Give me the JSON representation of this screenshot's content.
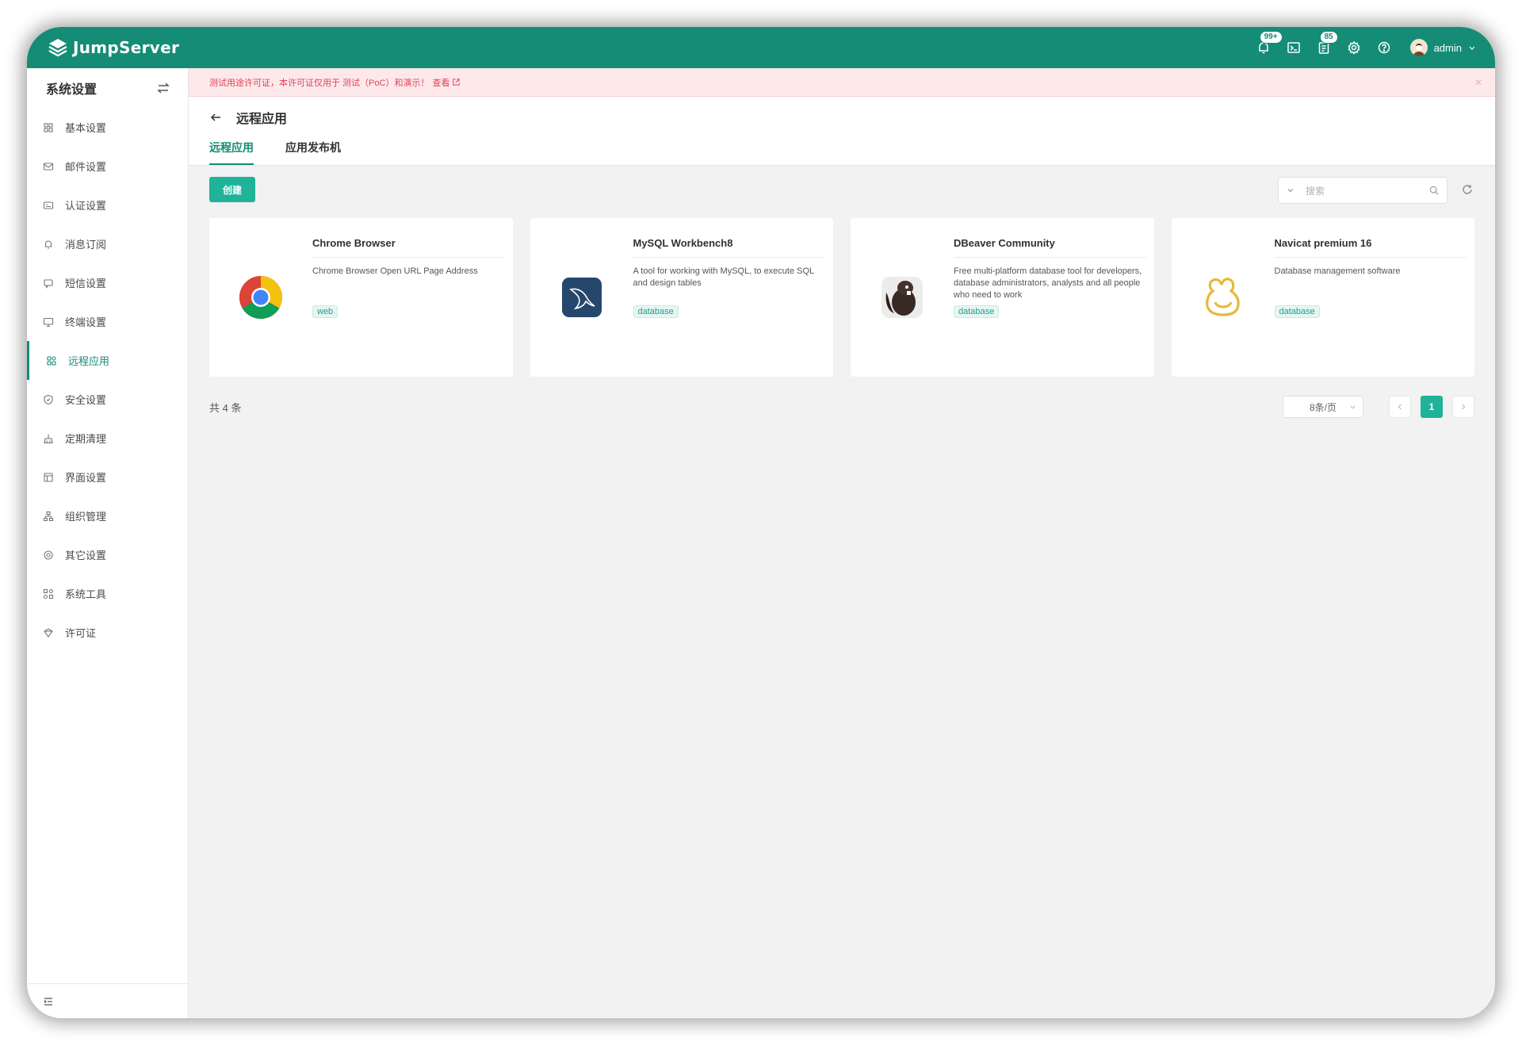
{
  "app": {
    "name": "JumpServer",
    "accent": "#148c76",
    "button_color": "#1fb39a"
  },
  "header": {
    "notifications_badge": "99+",
    "tickets_badge": "85",
    "icons": [
      "bell-icon",
      "terminal-icon",
      "clipboard-icon",
      "gear-icon",
      "help-icon"
    ],
    "user_name": "admin"
  },
  "sidebar": {
    "title": "系统设置",
    "items": [
      {
        "label": "基本设置",
        "icon": "grid-icon"
      },
      {
        "label": "邮件设置",
        "icon": "mail-icon"
      },
      {
        "label": "认证设置",
        "icon": "id-card-icon"
      },
      {
        "label": "消息订阅",
        "icon": "bell-icon"
      },
      {
        "label": "短信设置",
        "icon": "message-icon"
      },
      {
        "label": "终端设置",
        "icon": "monitor-icon"
      },
      {
        "label": "远程应用",
        "icon": "apps-icon",
        "active": true
      },
      {
        "label": "安全设置",
        "icon": "shield-icon"
      },
      {
        "label": "定期清理",
        "icon": "broom-icon"
      },
      {
        "label": "界面设置",
        "icon": "layout-icon"
      },
      {
        "label": "组织管理",
        "icon": "org-icon"
      },
      {
        "label": "其它设置",
        "icon": "settings-icon"
      },
      {
        "label": "系统工具",
        "icon": "tools-icon"
      },
      {
        "label": "许可证",
        "icon": "license-icon"
      }
    ]
  },
  "notice": {
    "text": "测试用途许可证，本许可证仅用于 测试（PoC）和演示！",
    "link": "查看"
  },
  "page": {
    "title": "远程应用",
    "tabs": [
      {
        "label": "远程应用",
        "active": true
      },
      {
        "label": "应用发布机",
        "active": false
      }
    ],
    "create_button": "创建",
    "search_placeholder": "搜索"
  },
  "cards": [
    {
      "name": "Chrome Browser",
      "description": "Chrome Browser Open URL Page Address",
      "tag": "web",
      "logo": "chrome-logo"
    },
    {
      "name": "MySQL Workbench8",
      "description": "A tool for working with MySQL, to execute SQL and design tables",
      "tag": "database",
      "logo": "mysql-dolphin-logo"
    },
    {
      "name": "DBeaver Community",
      "description": "Free multi-platform database tool for developers, database administrators, analysts and all people who need to work",
      "tag": "database",
      "logo": "dbeaver-logo"
    },
    {
      "name": "Navicat premium 16",
      "description": "Database management software",
      "tag": "database",
      "logo": "navicat-logo"
    }
  ],
  "pagination": {
    "total": "共 4 条",
    "page_size": "8条/页",
    "current_page": "1"
  }
}
